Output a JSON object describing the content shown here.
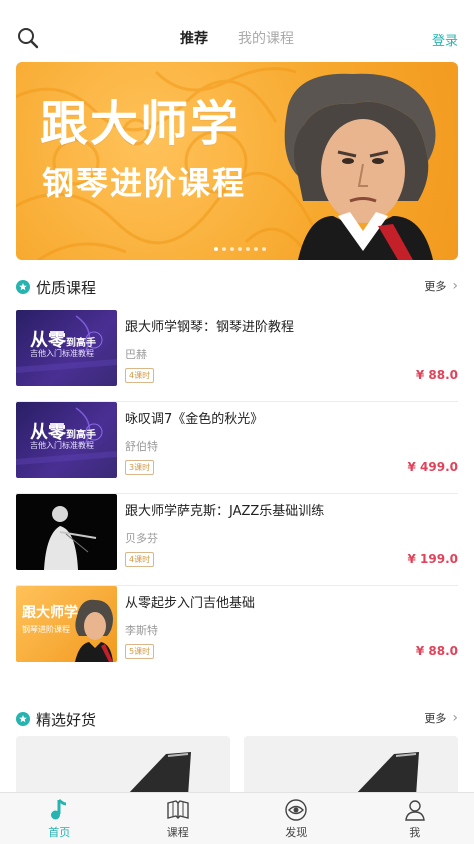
{
  "header": {
    "tabs": [
      {
        "label": "推荐",
        "active": true
      },
      {
        "label": "我的课程",
        "active": false
      }
    ],
    "login_label": "登录",
    "search_icon": "search-icon"
  },
  "banner": {
    "title": "跟大师学",
    "subtitle": "钢琴进阶课程",
    "dot_count": 7,
    "active_dot": 0
  },
  "section_courses": {
    "title": "优质课程",
    "more": "更多"
  },
  "courses": [
    {
      "title": "跟大师学钢琴：钢琴进阶教程",
      "author": "巴赫",
      "lessons": "4课时",
      "price": "¥ 88.0",
      "thumb_text": "从零",
      "thumb_text2": "到高手",
      "thumb_sub": "吉他入门标准教程"
    },
    {
      "title": "咏叹调7《金色的秋光》",
      "author": "舒伯特",
      "lessons": "3课时",
      "price": "¥ 499.0",
      "thumb_text": "从零",
      "thumb_text2": "到高手",
      "thumb_sub": "吉他入门标准教程"
    },
    {
      "title": "跟大师学萨克斯：JAZZ乐基础训练",
      "author": "贝多芬",
      "lessons": "4课时",
      "price": "¥ 199.0"
    },
    {
      "title": "从零起步入门吉他基础",
      "author": "李斯特",
      "lessons": "5课时",
      "price": "¥ 88.0",
      "thumb_text": "跟大师学",
      "thumb_sub": "钢琴进阶课程"
    }
  ],
  "section_goods": {
    "title": "精选好货",
    "more": "更多"
  },
  "bottom_nav": [
    {
      "label": "首页",
      "icon": "music-note-icon",
      "active": true
    },
    {
      "label": "课程",
      "icon": "book-icon",
      "active": false
    },
    {
      "label": "发现",
      "icon": "eye-icon",
      "active": false
    },
    {
      "label": "我",
      "icon": "user-icon",
      "active": false
    }
  ],
  "colors": {
    "accent": "#27b3b0",
    "price": "#e0435a",
    "banner": "#f7a92e"
  }
}
